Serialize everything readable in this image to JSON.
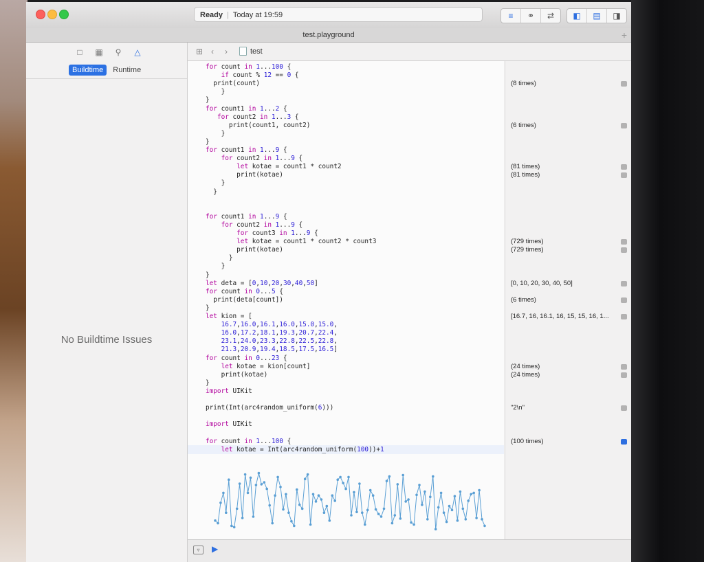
{
  "window": {
    "status": {
      "state": "Ready",
      "time": "Today at 19:59"
    },
    "tab_title": "test.playground",
    "tab_add": "+"
  },
  "navigator": {
    "scopes": [
      "Buildtime",
      "Runtime"
    ],
    "selected_scope": "Buildtime",
    "empty_message": "No Buildtime Issues",
    "icons": [
      "folder-icon",
      "hierarchy-icon",
      "search-icon",
      "warning-icon"
    ]
  },
  "jumpbar": {
    "file": "test"
  },
  "code": [
    "for count in 1...100 {",
    "    if count % 12 == 0 {",
    "  print(count)",
    "    }",
    "}",
    "for count1 in 1...2 {",
    "   for count2 in 1...3 {",
    "      print(count1, count2)",
    "    }",
    "}",
    "for count1 in 1...9 {",
    "    for count2 in 1...9 {",
    "        let kotae = count1 * count2",
    "        print(kotae)",
    "    }",
    "  }",
    "",
    "",
    "for count1 in 1...9 {",
    "    for count2 in 1...9 {",
    "        for count3 in 1...9 {",
    "        let kotae = count1 * count2 * count3",
    "        print(kotae)",
    "      }",
    "    }",
    "}",
    "let deta = [0,10,20,30,40,50]",
    "for count in 0...5 {",
    "  print(deta[count])",
    "}",
    "let kion = [",
    "    16.7,16.0,16.1,16.0,15.0,15.0,",
    "    16.0,17.2,18.1,19.3,20.7,22.4,",
    "    23.1,24.0,23.3,22.8,22.5,22.8,",
    "    21.3,20.9,19.4,18.5,17.5,16.5]",
    "for count in 0...23 {",
    "    let kotae = kion[count]",
    "    print(kotae)",
    "}",
    "import UIKit",
    "",
    "print(Int(arc4random_uniform(6)))",
    "",
    "import UIKit",
    "",
    "for count in 1...100 {",
    "    let kotae = Int(arc4random_uniform(100))+1"
  ],
  "results": [
    {
      "line": 2,
      "text": "(8 times)"
    },
    {
      "line": 7,
      "text": "(6 times)"
    },
    {
      "line": 12,
      "text": "(81 times)"
    },
    {
      "line": 13,
      "text": "(81 times)"
    },
    {
      "line": 21,
      "text": "(729 times)"
    },
    {
      "line": 22,
      "text": "(729 times)"
    },
    {
      "line": 26,
      "text": "[0, 10, 20, 30, 40, 50]"
    },
    {
      "line": 28,
      "text": "(6 times)"
    },
    {
      "line": 30,
      "text": "[16.7, 16, 16.1, 16, 15, 15, 16, 1..."
    },
    {
      "line": 36,
      "text": "(24 times)"
    },
    {
      "line": 37,
      "text": "(24 times)"
    },
    {
      "line": 41,
      "text": "\"2\\n\""
    },
    {
      "line": 45,
      "text": "(100 times)"
    }
  ],
  "chart_data": {
    "type": "line",
    "x": [
      1,
      2,
      3,
      4,
      5,
      6,
      7,
      8,
      9,
      10,
      11,
      12,
      13,
      14,
      15,
      16,
      17,
      18,
      19,
      20,
      21,
      22,
      23,
      24,
      25,
      26,
      27,
      28,
      29,
      30,
      31,
      32,
      33,
      34,
      35,
      36,
      37,
      38,
      39,
      40,
      41,
      42,
      43,
      44,
      45,
      46,
      47,
      48,
      49,
      50,
      51,
      52,
      53,
      54,
      55,
      56,
      57,
      58,
      59,
      60,
      61,
      62,
      63,
      64,
      65,
      66,
      67,
      68,
      69,
      70,
      71,
      72,
      73,
      74,
      75,
      76,
      77,
      78,
      79,
      80,
      81,
      82,
      83,
      84,
      85,
      86,
      87,
      88,
      89,
      90,
      91,
      92,
      93,
      94,
      95,
      96,
      97,
      98,
      99,
      100
    ],
    "values": [
      18,
      14,
      45,
      60,
      30,
      80,
      10,
      8,
      36,
      74,
      22,
      88,
      60,
      83,
      24,
      72,
      90,
      73,
      76,
      66,
      41,
      14,
      56,
      84,
      69,
      35,
      58,
      30,
      17,
      10,
      65,
      42,
      36,
      81,
      88,
      12,
      58,
      47,
      56,
      50,
      30,
      40,
      18,
      56,
      48,
      80,
      84,
      75,
      66,
      84,
      26,
      61,
      31,
      74,
      30,
      12,
      34,
      64,
      56,
      35,
      28,
      24,
      36,
      78,
      85,
      14,
      26,
      73,
      21,
      87,
      47,
      50,
      15,
      12,
      57,
      72,
      42,
      62,
      20,
      54,
      85,
      5,
      38,
      60,
      30,
      16,
      40,
      34,
      55,
      18,
      62,
      36,
      20,
      48,
      58,
      60,
      22,
      64,
      20,
      10
    ]
  },
  "colors": {
    "accent": "#2c71e3",
    "plot": "#5a9fd4",
    "keyword": "#b1009c",
    "number": "#2a1cd6"
  }
}
